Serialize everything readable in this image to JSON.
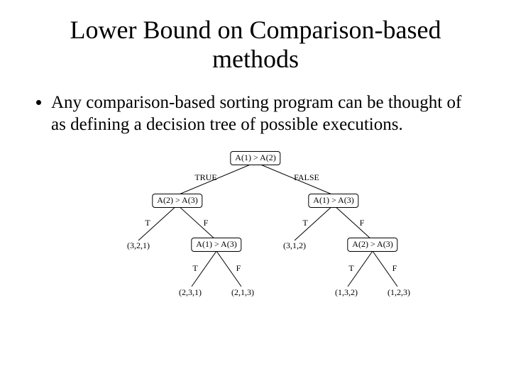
{
  "title": "Lower Bound on Comparison-based methods",
  "bullet": "Any comparison-based sorting program can be thought of as defining a decision tree of possible executions.",
  "tree": {
    "root": "A(1) > A(2)",
    "edge_root_left": "TRUE",
    "edge_root_right": "FALSE",
    "L": "A(2) > A(3)",
    "R": "A(1) > A(3)",
    "T": "T",
    "F": "F",
    "LL_leaf": "(3,2,1)",
    "LR_node": "A(1) > A(3)",
    "RL_leaf": "(3,1,2)",
    "RR_node": "A(2) > A(3)",
    "LRL_leaf": "(2,3,1)",
    "LRR_leaf": "(2,1,3)",
    "RRL_leaf": "(1,3,2)",
    "RRR_leaf": "(1,2,3)"
  }
}
